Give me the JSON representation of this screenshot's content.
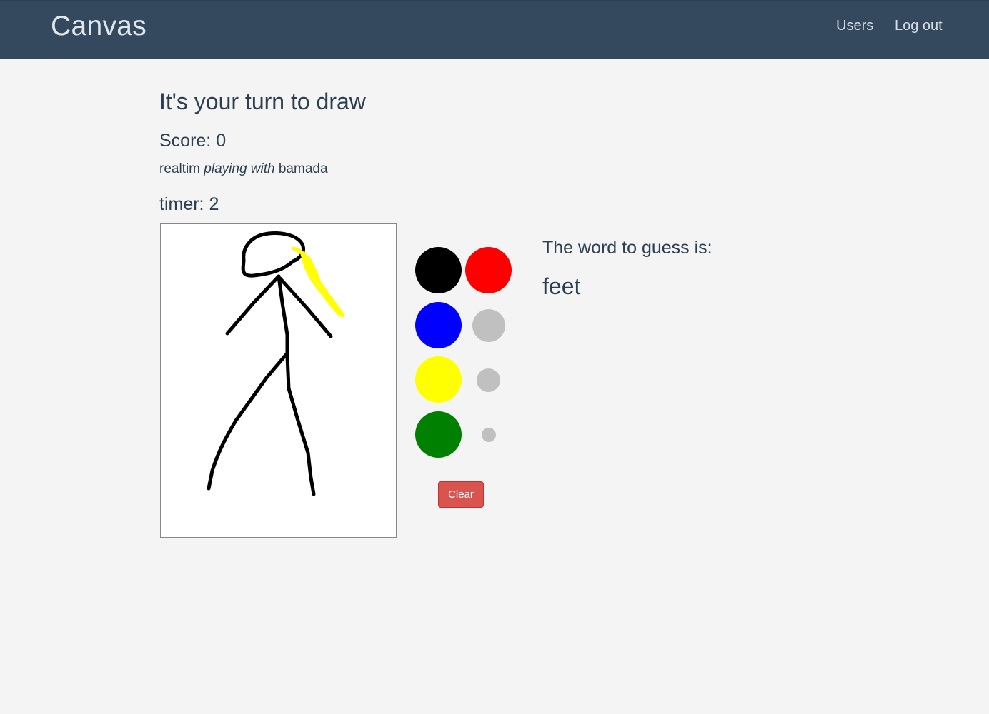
{
  "navbar": {
    "brand": "Canvas",
    "links": [
      "Users",
      "Log out"
    ]
  },
  "game": {
    "title": "It's your turn to draw",
    "score_label": "Score:",
    "score": "0",
    "player": "realtim",
    "playing_with_label": "playing with",
    "opponent": "bamada",
    "timer_label": "timer:",
    "timer": "2"
  },
  "palette": {
    "colors": [
      {
        "name": "black",
        "hex": "#000000"
      },
      {
        "name": "red",
        "hex": "#ff0000"
      },
      {
        "name": "blue",
        "hex": "#0000ff"
      },
      {
        "name": "yellow",
        "hex": "#ffff00"
      },
      {
        "name": "green",
        "hex": "#008000"
      }
    ],
    "brush_sizes": [
      "large",
      "medium",
      "small"
    ],
    "brush_color": "#c0c0c0",
    "clear_label": "Clear",
    "clear_color": "#d9534f"
  },
  "guess": {
    "label": "The word to guess is:",
    "word": "feet"
  }
}
